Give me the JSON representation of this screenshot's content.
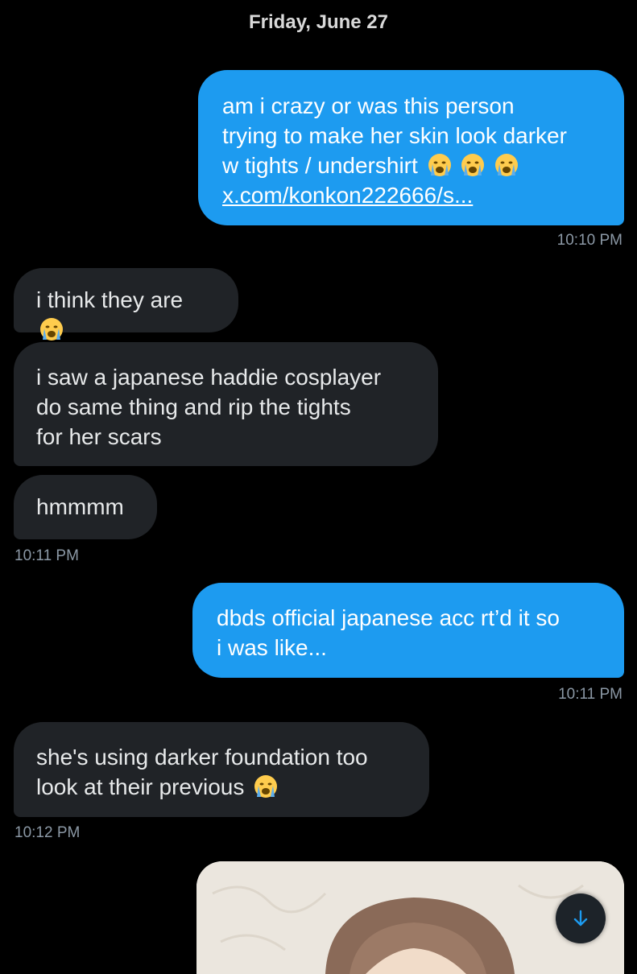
{
  "date_header": "Friday, June 27",
  "messages": [
    {
      "direction": "out",
      "lines": [
        "am i crazy or was this person",
        "trying to make her skin look darker",
        "w tights / undershirt"
      ],
      "emoji": [
        "loudly-crying-face",
        "loudly-crying-face",
        "loudly-crying-face"
      ],
      "link": "x.com/konkon222666/s..."
    },
    {
      "direction": "in",
      "lines": [
        "i think they are"
      ],
      "emoji": [
        "loudly-crying-face"
      ]
    },
    {
      "direction": "in",
      "lines": [
        "i saw a japanese haddie cosplayer",
        "do same thing and rip the tights",
        "for her scars"
      ]
    },
    {
      "direction": "in",
      "lines": [
        "hmmmm"
      ]
    },
    {
      "direction": "out",
      "lines": [
        "dbds official japanese acc rt’d it so",
        "i was like..."
      ]
    },
    {
      "direction": "in",
      "lines": [
        "she's using darker foundation too",
        "look at their previous"
      ],
      "emoji": [
        "loudly-crying-face"
      ]
    },
    {
      "direction": "out",
      "type": "image",
      "description": "photo of a person with brown hair"
    }
  ],
  "timestamps": [
    "10:10 PM",
    "10:11 PM",
    "10:11 PM",
    "10:12 PM"
  ],
  "scroll_button_icon": "arrow-down-icon",
  "colors": {
    "outgoing": "#1d9bf0",
    "incoming": "#202327",
    "background": "#000000",
    "timestamp": "#8b98a5"
  }
}
